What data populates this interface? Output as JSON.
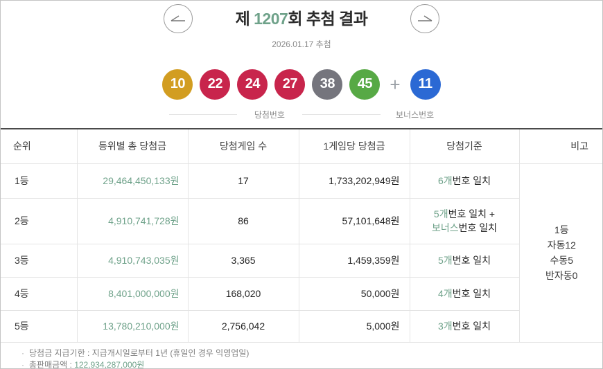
{
  "header": {
    "title_prefix": "제 ",
    "round": "1207",
    "title_suffix": "회 추첨 결과",
    "draw_date": "2026.01.17 추첨"
  },
  "numbers": {
    "main": [
      {
        "value": "10",
        "color": "#d29d21"
      },
      {
        "value": "22",
        "color": "#c8254c"
      },
      {
        "value": "24",
        "color": "#c8254c"
      },
      {
        "value": "27",
        "color": "#c8254c"
      },
      {
        "value": "38",
        "color": "#75757d"
      },
      {
        "value": "45",
        "color": "#57a945"
      }
    ],
    "plus": "+",
    "bonus": {
      "value": "11",
      "color": "#2b69d4"
    },
    "main_label": "당첨번호",
    "bonus_label": "보너스번호"
  },
  "table": {
    "headers": [
      "순위",
      "등위별 총 당첨금",
      "당첨게임 수",
      "1게임당 당첨금",
      "당첨기준",
      "비고"
    ],
    "rows": [
      {
        "rank": "1등",
        "total_prize": "29,464,450,133원",
        "winning_games": "17",
        "prize_per_game": "1,733,202,949원",
        "criteria": [
          {
            "green": "6개",
            "rest": "번호 일치"
          }
        ]
      },
      {
        "rank": "2등",
        "total_prize": "4,910,741,728원",
        "winning_games": "86",
        "prize_per_game": "57,101,648원",
        "criteria": [
          {
            "green": "5개",
            "rest": "번호 일치 +"
          },
          {
            "green": "보너스",
            "rest": "번호 일치"
          }
        ]
      },
      {
        "rank": "3등",
        "total_prize": "4,910,743,035원",
        "winning_games": "3,365",
        "prize_per_game": "1,459,359원",
        "criteria": [
          {
            "green": "5개",
            "rest": "번호 일치"
          }
        ]
      },
      {
        "rank": "4등",
        "total_prize": "8,401,000,000원",
        "winning_games": "168,020",
        "prize_per_game": "50,000원",
        "criteria": [
          {
            "green": "4개",
            "rest": "번호 일치"
          }
        ]
      },
      {
        "rank": "5등",
        "total_prize": "13,780,210,000원",
        "winning_games": "2,756,042",
        "prize_per_game": "5,000원",
        "criteria": [
          {
            "green": "3개",
            "rest": "번호 일치"
          }
        ]
      }
    ],
    "note_lines": [
      "1등",
      "자동12",
      "수동5",
      "반자동0"
    ]
  },
  "footer": {
    "bullet": "·",
    "notes": [
      {
        "text": "당첨금 지급기한 : 지급개시일로부터 1년 (휴일인 경우 익영업일)",
        "amount": ""
      },
      {
        "text": "총판매금액 : ",
        "amount": "122,934,287,000원"
      }
    ]
  },
  "colors": {
    "accent_green": "#6fa28a"
  }
}
